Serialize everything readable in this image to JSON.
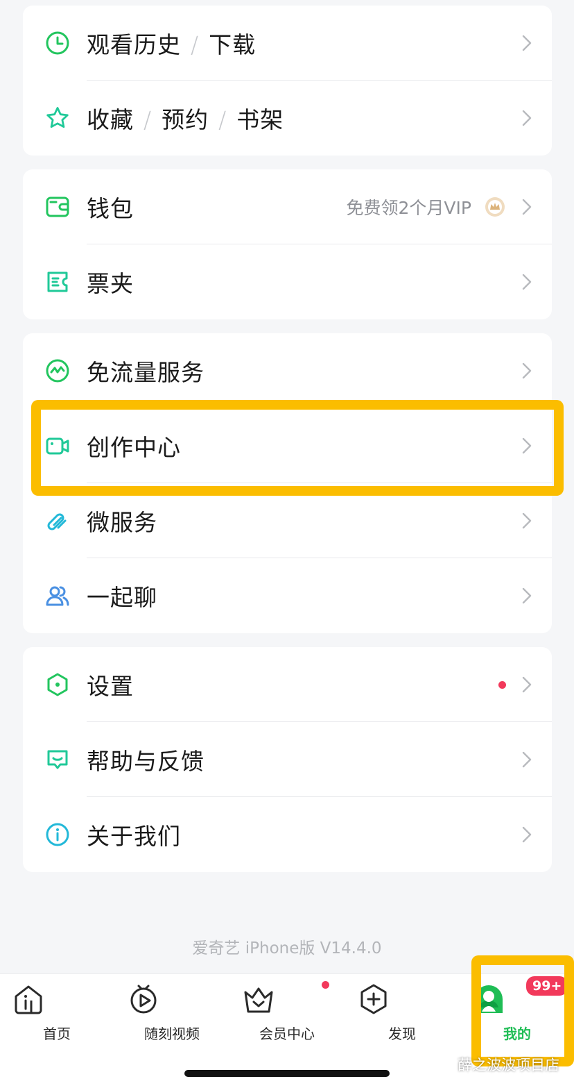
{
  "groups": [
    {
      "items": [
        {
          "icon": "clock-icon",
          "parts": [
            "观看历史",
            "下载"
          ]
        },
        {
          "icon": "star-icon",
          "parts": [
            "收藏",
            "预约",
            "书架"
          ]
        }
      ]
    },
    {
      "items": [
        {
          "icon": "wallet-icon",
          "label": "钱包",
          "extra": "免费领2个月VIP",
          "extra_icon": "crown-badge-icon"
        },
        {
          "icon": "ticket-icon",
          "label": "票夹"
        }
      ]
    },
    {
      "items": [
        {
          "icon": "data-traffic-icon",
          "label": "免流量服务"
        },
        {
          "icon": "video-camera-icon",
          "label": "创作中心",
          "highlighted": true
        },
        {
          "icon": "link-icon",
          "label": "微服务"
        },
        {
          "icon": "people-icon",
          "label": "一起聊"
        }
      ]
    },
    {
      "items": [
        {
          "icon": "settings-hexagon-icon",
          "label": "设置",
          "notification_dot": true
        },
        {
          "icon": "feedback-icon",
          "label": "帮助与反馈"
        },
        {
          "icon": "info-icon",
          "label": "关于我们"
        }
      ]
    }
  ],
  "version": "爱奇艺 iPhone版 V14.4.0",
  "tabs": [
    {
      "icon": "home-icon",
      "label": "首页"
    },
    {
      "icon": "play-clock-icon",
      "label": "随刻视频"
    },
    {
      "icon": "vip-crown-icon",
      "label": "会员中心",
      "notification_dot": true
    },
    {
      "icon": "plus-icon",
      "label": "发现"
    },
    {
      "icon": "profile-avatar-icon",
      "label": "我的",
      "active": true,
      "badge": "99+"
    }
  ],
  "colors": {
    "accent_green": "#1fbd55",
    "icon_teal": "#20c998",
    "highlight": "#fbbd00",
    "badge_red": "#f2395b"
  },
  "watermark": "薛之波波项目店"
}
